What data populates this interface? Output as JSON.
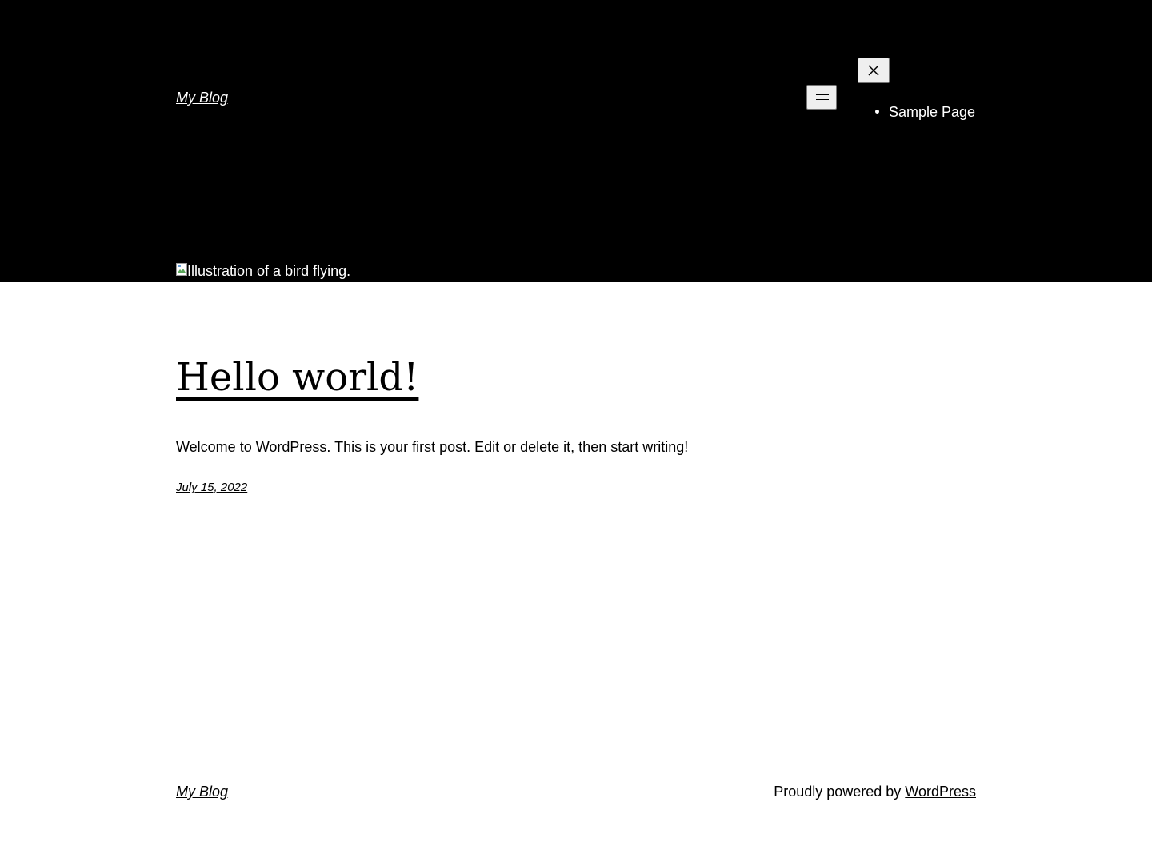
{
  "header": {
    "site_title": "My Blog",
    "nav_items": [
      {
        "label": "Sample Page"
      }
    ],
    "hero_image_alt": "Illustration of a bird flying."
  },
  "post": {
    "title": "Hello world!",
    "excerpt": "Welcome to WordPress. This is your first post. Edit or delete it, then start writing!",
    "date": "July 15, 2022"
  },
  "footer": {
    "site_title": "My Blog",
    "powered_prefix": "Proudly powered by ",
    "powered_link": "WordPress"
  },
  "colors": {
    "header_background": "#000000",
    "page_background": "#ffffff",
    "header_text": "#ffffff",
    "body_text": "#000000"
  }
}
